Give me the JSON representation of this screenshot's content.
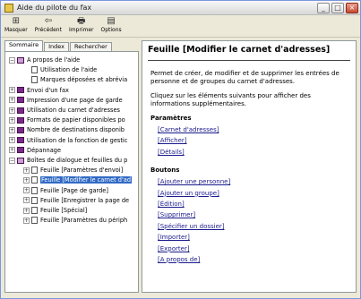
{
  "window": {
    "title": "Aide du pilote du fax"
  },
  "titlebar_buttons": {
    "minimize": "_",
    "maximize": "□",
    "close": "×"
  },
  "toolbar": [
    {
      "icon": "masquer-icon",
      "glyph": "⊞",
      "label": "Masquer"
    },
    {
      "icon": "back-icon",
      "glyph": "⇦",
      "label": "Précédent"
    },
    {
      "icon": "print-icon",
      "glyph": "🖶",
      "label": "Imprimer"
    },
    {
      "icon": "options-icon",
      "glyph": "▤",
      "label": "Options"
    }
  ],
  "tabs": [
    "Sommaire",
    "Index",
    "Rechercher"
  ],
  "tree": [
    {
      "expander": "−",
      "icon": "book-open",
      "label": "A propos de l'aide"
    },
    {
      "expander": "",
      "icon": "page",
      "label": "Utilisation de l'aide"
    },
    {
      "expander": "",
      "icon": "page",
      "label": "Marques déposées et abrévia"
    },
    {
      "expander": "+",
      "icon": "book",
      "label": "Envoi d'un fax"
    },
    {
      "expander": "+",
      "icon": "book",
      "label": "Impression d'une page de garde"
    },
    {
      "expander": "+",
      "icon": "book",
      "label": "Utilisation du carnet d'adresses"
    },
    {
      "expander": "+",
      "icon": "book",
      "label": "Formats de papier disponibles po"
    },
    {
      "expander": "+",
      "icon": "book",
      "label": "Nombre de destinations disponib"
    },
    {
      "expander": "+",
      "icon": "book",
      "label": "Utilisation de la fonction de gestic"
    },
    {
      "expander": "+",
      "icon": "book",
      "label": "Dépannage"
    },
    {
      "expander": "−",
      "icon": "book-open",
      "label": "Boîtes de dialogue et feuilles du p"
    },
    {
      "expander": "+",
      "icon": "page",
      "label": "Feuille [Paramètres d'envoi]"
    },
    {
      "expander": "+",
      "icon": "page",
      "label": "Feuille [Modifier le carnet d'ad"
    },
    {
      "expander": "+",
      "icon": "page",
      "label": "Feuille [Page de garde]"
    },
    {
      "expander": "+",
      "icon": "page",
      "label": "Feuille [Enregistrer la page de"
    },
    {
      "expander": "+",
      "icon": "page",
      "label": "Feuille [Spécial]"
    },
    {
      "expander": "+",
      "icon": "page",
      "label": "Feuille [Paramètres du périph"
    }
  ],
  "content": {
    "title": "Feuille [Modifier le carnet d'adresses]",
    "intro": "Permet de créer, de modifier et de supprimer les entrées de personne et de groupes du carnet d'adresses.",
    "instruction": "Cliquez sur les éléments suivants pour afficher des informations supplémentaires.",
    "params_heading": "Paramètres",
    "params": [
      "[Carnet d'adresses]",
      "[Afficher]",
      "[Détails]"
    ],
    "buttons_heading": "Boutons",
    "buttons": [
      "[Ajouter une personne]",
      "[Ajouter un groupe]",
      "[Édition]",
      "[Supprimer]",
      "[Spécifier un dossier]",
      "[Importer]",
      "[Exporter]",
      "[A propos de]"
    ]
  }
}
